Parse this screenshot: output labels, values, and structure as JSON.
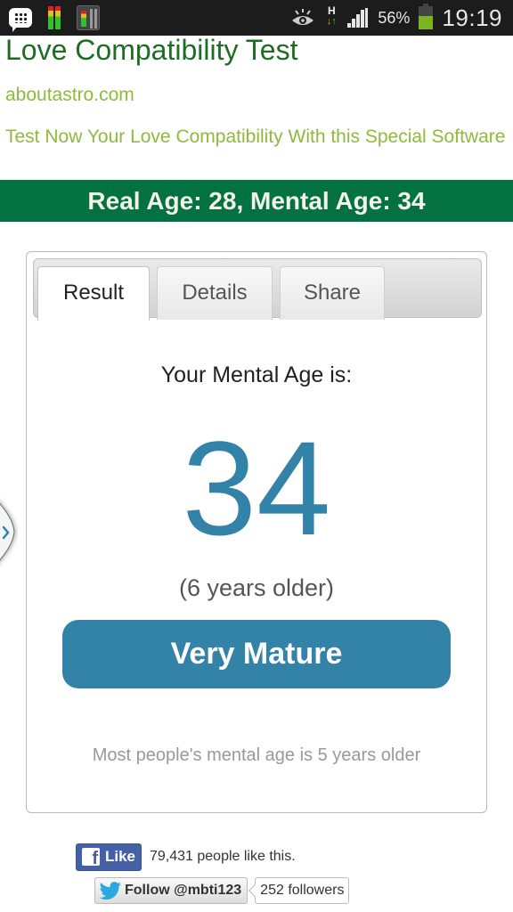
{
  "status_bar": {
    "battery_percent": "56%",
    "battery_level": 0.56,
    "network_type": "H",
    "time": "19:19",
    "icons": [
      "bbm-icon",
      "equalizer-icon",
      "mixer-app-icon",
      "eye-icon",
      "hspa-data-icon",
      "signal-icon",
      "battery-icon"
    ]
  },
  "header": {
    "title": "Love Compatibility Test",
    "domain": "aboutastro.com",
    "tagline": "Test Now Your Love Compatibility With this Special Software"
  },
  "banner": {
    "text": "Real Age: 28, Mental Age: 34"
  },
  "result_card": {
    "tabs": [
      {
        "label": "Result",
        "active": true
      },
      {
        "label": "Details",
        "active": false
      },
      {
        "label": "Share",
        "active": false
      }
    ],
    "question": "Your Mental Age is:",
    "mental_age": "34",
    "difference": "(6 years older)",
    "verdict": "Very Mature",
    "note": "Most people's mental age is 5 years older"
  },
  "side_drawer": {
    "icon": "chevron-right-icon"
  },
  "social": {
    "facebook": {
      "like_label": "Like",
      "count_text": "79,431 people like this."
    },
    "twitter": {
      "follow_label": "Follow @mbti123",
      "followers_text": "252 followers"
    }
  },
  "colors": {
    "title_green": "#1f6d24",
    "link_green": "#8fba3a",
    "banner_green": "#037141",
    "accent_blue": "#3383a8",
    "facebook_blue": "#4461a8",
    "twitter_blue": "#2aa9e0"
  }
}
